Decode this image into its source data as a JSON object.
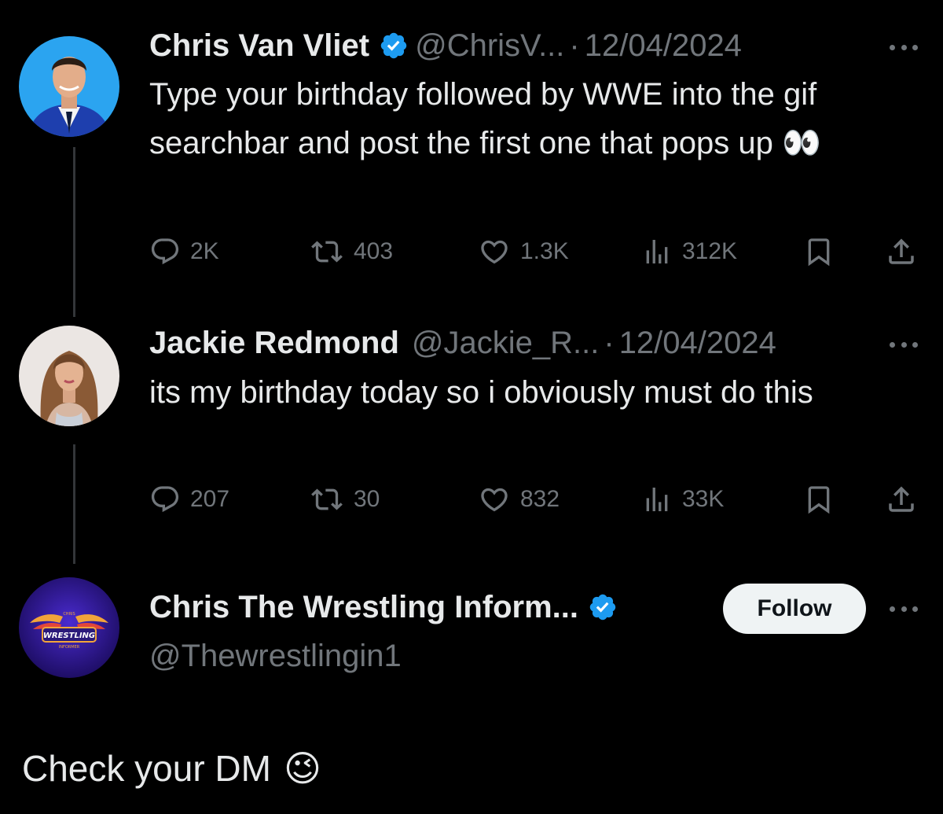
{
  "colors": {
    "background": "#000000",
    "text_primary": "#e7e9ea",
    "text_secondary": "#71767b",
    "verified_blue": "#1d9bf0",
    "follow_button_bg": "#eff3f4"
  },
  "tweets": [
    {
      "name": "Chris Van Vliet",
      "verified": true,
      "handle": "@ChrisV...",
      "separator": "·",
      "date": "12/04/2024",
      "text": "Type your birthday followed by WWE into the gif searchbar and post the first one that pops up 👀",
      "stats": {
        "replies": "2K",
        "reposts": "403",
        "likes": "1.3K",
        "views": "312K"
      }
    },
    {
      "name": "Jackie Redmond",
      "verified": false,
      "handle": "@Jackie_R...",
      "separator": "·",
      "date": "12/04/2024",
      "text": "its my birthday today so i obviously must do this",
      "stats": {
        "replies": "207",
        "reposts": "30",
        "likes": "832",
        "views": "33K"
      }
    }
  ],
  "suggested_account": {
    "name": "Chris The Wrestling Inform...",
    "verified": true,
    "handle": "@Thewrestlingin1",
    "follow_label": "Follow",
    "logo_text": "WRESTLING",
    "logo_subtext_top": "CHRIS",
    "logo_subtext_bottom": "INFORMER"
  },
  "caption": {
    "text": "Check your DM",
    "emoji": "😉"
  },
  "icons": {
    "reply": "reply-icon",
    "repost": "repost-icon",
    "like": "heart-icon",
    "views": "views-icon",
    "bookmark": "bookmark-icon",
    "share": "share-icon",
    "more": "more-icon",
    "verified": "verified-badge-icon"
  }
}
